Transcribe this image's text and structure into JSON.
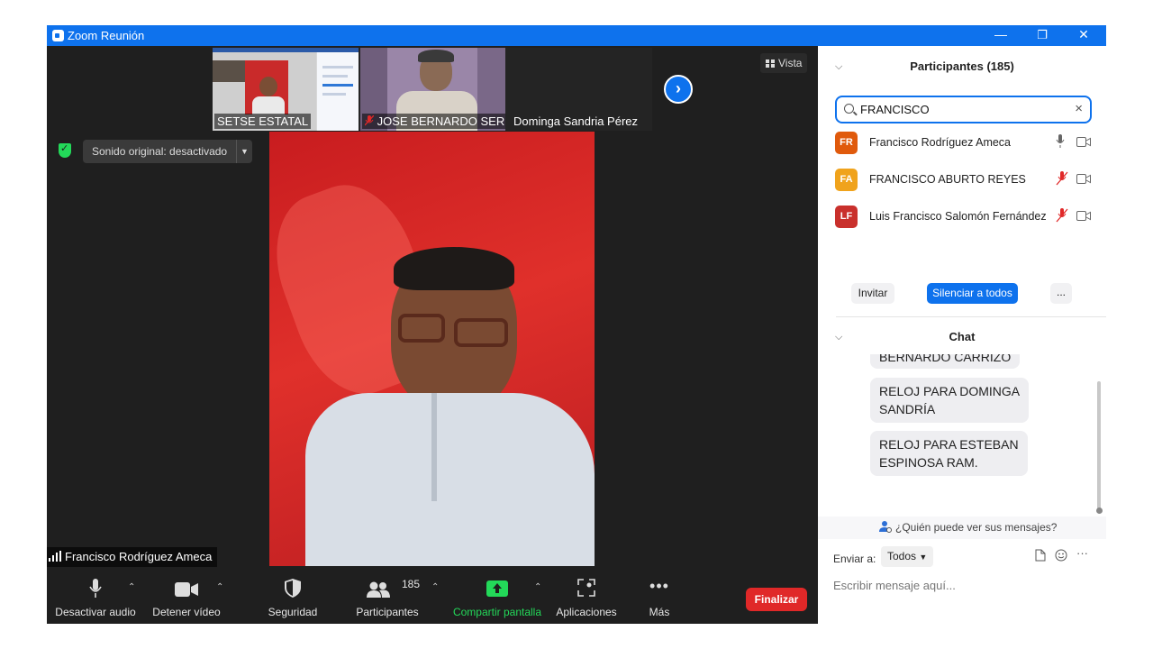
{
  "window": {
    "title": "Zoom Reunión",
    "minimize": "—",
    "restore": "❐",
    "close": "✕"
  },
  "thumbnails": [
    {
      "name": "SETSE ESTATAL"
    },
    {
      "name": "JOSE BERNARDO SER..."
    },
    {
      "name": "Dominga Sandria Pérez"
    }
  ],
  "view_button": {
    "label": "Vista"
  },
  "original_sound": {
    "label": "Sonido original: desactivado"
  },
  "active_speaker": {
    "name": "Francisco Rodríguez Ameca"
  },
  "toolbar": {
    "audio_label": "Desactivar audio",
    "video_label": "Detener vídeo",
    "security_label": "Seguridad",
    "participants_label": "Participantes",
    "participants_count": "185",
    "share_label": "Compartir pantalla",
    "apps_label": "Aplicaciones",
    "more_label": "Más",
    "end_label": "Finalizar"
  },
  "participants_panel": {
    "title": "Participantes (185)",
    "search_value": "FRANCISCO",
    "items": [
      {
        "initials": "FR",
        "name": "Francisco Rodríguez Ameca",
        "color": "#e05a0c",
        "muted": false
      },
      {
        "initials": "FA",
        "name": "FRANCISCO ABURTO REYES",
        "color": "#f0a31c",
        "muted": true
      },
      {
        "initials": "LF",
        "name": "Luis Francisco Salomón Fernández",
        "color": "#c9302c",
        "muted": true
      }
    ],
    "invite_label": "Invitar",
    "mute_all_label": "Silenciar a todos",
    "more_label": "..."
  },
  "chat_panel": {
    "title": "Chat",
    "messages": [
      {
        "text": "BERNARDO CARRIZO"
      },
      {
        "line1": "RELOJ PARA DOMINGA",
        "line2": "SANDRÍA"
      },
      {
        "line1": "RELOJ PARA ESTEBAN",
        "line2": "ESPINOSA RAM."
      }
    ],
    "who_can_see": "¿Quién puede ver sus mensajes?",
    "send_to_label": "Enviar a:",
    "send_to_value": "Todos",
    "placeholder": "Escribir mensaje aquí..."
  },
  "colors": {
    "accent": "#0e72ed",
    "end_button": "#e02828",
    "share_green": "#23d959"
  }
}
